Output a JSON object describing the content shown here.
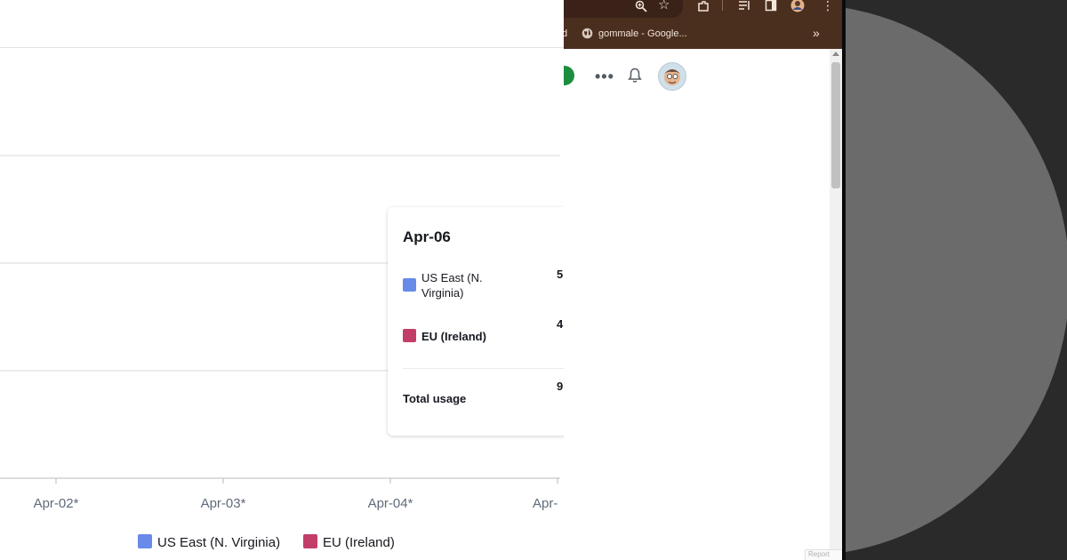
{
  "chart_data": {
    "type": "bar",
    "x_tick_labels": [
      "Apr-02*",
      "Apr-03*",
      "Apr-04*",
      "Apr-"
    ],
    "legend": [
      {
        "name": "US East (N. Virginia)",
        "color": "#688ae8"
      },
      {
        "name": "EU (Ireland)",
        "color": "#c33d69"
      }
    ],
    "grid": true,
    "tooltip": {
      "title": "Apr-06",
      "rows": [
        {
          "label_line1": "US East (N.",
          "label_line2": "Virginia)",
          "value": "5",
          "color": "#688ae8"
        },
        {
          "label": "EU (Ireland)",
          "value": "4",
          "color": "#c33d69"
        }
      ],
      "total_label": "Total usage",
      "total_value": "9"
    }
  },
  "browser": {
    "bookmark_partial": "d",
    "bookmark_label": "gommale - Google...",
    "overflow_icon": "chevron-double-right-icon",
    "toolbar_icons": [
      "zoom-icon",
      "star-icon",
      "extensions-icon",
      "reading-list-icon",
      "side-panel-icon",
      "profile-icon",
      "more-vert-icon"
    ],
    "header_icons": [
      "more-horizontal-icon",
      "bell-icon",
      "avatar"
    ],
    "feedback_label": "Report"
  },
  "colors": {
    "browser_frame": "#4a2e1e",
    "desktop_bg": "#2a2a2a",
    "desktop_circle": "#6b6b6b"
  }
}
